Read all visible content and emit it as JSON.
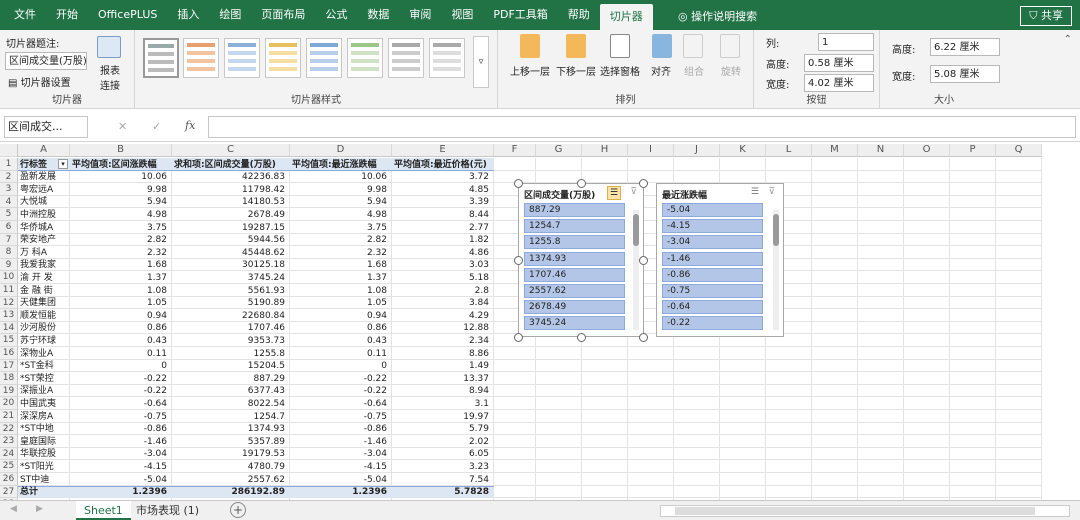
{
  "menu_tabs": [
    "文件",
    "开始",
    "OfficePLUS",
    "插入",
    "绘图",
    "页面布局",
    "公式",
    "数据",
    "审阅",
    "视图",
    "PDF工具箱",
    "帮助",
    "切片器"
  ],
  "active_tab": "切片器",
  "search_label": "操作说明搜索",
  "share_label": "共享",
  "ribbon": {
    "slicer_caption_label": "切片器题注:",
    "slicer_caption_value": "区间成交量(万股)",
    "slicer_settings": "切片器设置",
    "report_connections": "报表连接",
    "group_slicer": "切片器",
    "group_styles": "切片器样式",
    "move_up": "上移一层",
    "move_down": "下移一层",
    "selection_pane": "选择窗格",
    "align": "对齐",
    "group_btn": "组合",
    "rotate": "旋转",
    "group_arrange": "排列",
    "columns_label": "列:",
    "columns_value": "1",
    "btn_height_label": "高度:",
    "btn_height_value": "0.58 厘米",
    "btn_width_label": "宽度:",
    "btn_width_value": "4.02 厘米",
    "group_buttons": "按钮",
    "height_label": "高度:",
    "height_value": "6.22 厘米",
    "width_label": "宽度:",
    "width_value": "5.08 厘米",
    "group_size": "大小"
  },
  "name_box": "区间成交...",
  "fx_label": "fx",
  "columns": [
    "A",
    "B",
    "C",
    "D",
    "E",
    "F",
    "G",
    "H",
    "I",
    "J",
    "K",
    "L",
    "M",
    "N",
    "O",
    "P",
    "Q"
  ],
  "table": {
    "headers": [
      "行标签",
      "平均值项:区间涨跌幅",
      "求和项:区间成交量(万股)",
      "平均值项:最近涨跌幅",
      "平均值项:最近价格(元)"
    ],
    "rows": [
      [
        "盈新发展",
        "10.06",
        "42236.83",
        "10.06",
        "3.72"
      ],
      [
        "粤宏远A",
        "9.98",
        "11798.42",
        "9.98",
        "4.85"
      ],
      [
        "大悦城",
        "5.94",
        "14180.53",
        "5.94",
        "3.39"
      ],
      [
        "中洲控股",
        "4.98",
        "2678.49",
        "4.98",
        "8.44"
      ],
      [
        "华侨城A",
        "3.75",
        "19287.15",
        "3.75",
        "2.77"
      ],
      [
        "荣安地产",
        "2.82",
        "5944.56",
        "2.82",
        "1.82"
      ],
      [
        "万 科A",
        "2.32",
        "45448.62",
        "2.32",
        "4.86"
      ],
      [
        "我爱我家",
        "1.68",
        "30125.18",
        "1.68",
        "3.03"
      ],
      [
        "渝 开 发",
        "1.37",
        "3745.24",
        "1.37",
        "5.18"
      ],
      [
        "金 融 街",
        "1.08",
        "5561.93",
        "1.08",
        "2.8"
      ],
      [
        "天健集团",
        "1.05",
        "5190.89",
        "1.05",
        "3.84"
      ],
      [
        "顺发恒能",
        "0.94",
        "22680.84",
        "0.94",
        "4.29"
      ],
      [
        "沙河股份",
        "0.86",
        "1707.46",
        "0.86",
        "12.88"
      ],
      [
        "苏宁环球",
        "0.43",
        "9353.73",
        "0.43",
        "2.34"
      ],
      [
        "深物业A",
        "0.11",
        "1255.8",
        "0.11",
        "8.86"
      ],
      [
        "*ST金科",
        "0",
        "15204.5",
        "0",
        "1.49"
      ],
      [
        "*ST荣控",
        "-0.22",
        "887.29",
        "-0.22",
        "13.37"
      ],
      [
        "深振业A",
        "-0.22",
        "6377.43",
        "-0.22",
        "8.94"
      ],
      [
        "中国武夷",
        "-0.64",
        "8022.54",
        "-0.64",
        "3.1"
      ],
      [
        "深深房A",
        "-0.75",
        "1254.7",
        "-0.75",
        "19.97"
      ],
      [
        "*ST中地",
        "-0.86",
        "1374.93",
        "-0.86",
        "5.79"
      ],
      [
        "皇庭国际",
        "-1.46",
        "5357.89",
        "-1.46",
        "2.02"
      ],
      [
        "华联控股",
        "-3.04",
        "19179.53",
        "-3.04",
        "6.05"
      ],
      [
        "*ST阳光",
        "-4.15",
        "4780.79",
        "-4.15",
        "3.23"
      ],
      [
        "ST中迪",
        "-5.04",
        "2557.62",
        "-5.04",
        "7.54"
      ]
    ],
    "total": [
      "总计",
      "1.2396",
      "286192.89",
      "1.2396",
      "5.7828"
    ]
  },
  "slicer1": {
    "title": "区间成交量(万股)",
    "items": [
      "887.29",
      "1254.7",
      "1255.8",
      "1374.93",
      "1707.46",
      "2557.62",
      "2678.49",
      "3745.24"
    ]
  },
  "slicer2": {
    "title": "最近涨跌幅",
    "items": [
      "-5.04",
      "-4.15",
      "-3.04",
      "-1.46",
      "-0.86",
      "-0.75",
      "-0.64",
      "-0.22"
    ]
  },
  "sheet_tabs": [
    "Sheet1",
    "市场表现 (1)"
  ],
  "accent": "#217346"
}
